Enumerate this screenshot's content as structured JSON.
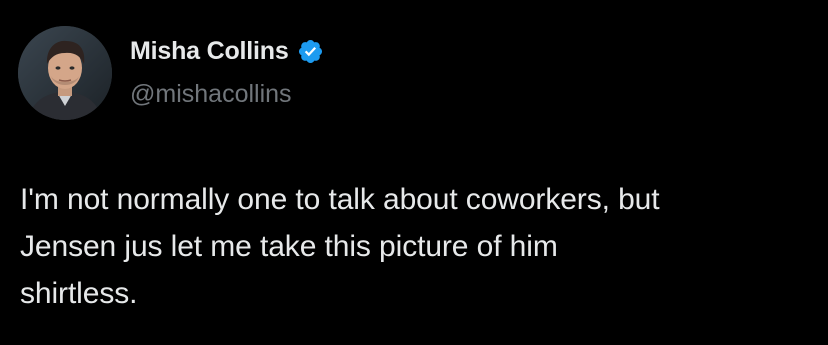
{
  "author": {
    "display_name": "Misha Collins",
    "handle": "@mishacollins",
    "verified": true,
    "verified_icon": "verified-badge-icon",
    "verified_color": "#1d9bf0",
    "avatar_icon": "profile-photo"
  },
  "tweet": {
    "lines": [
      "I'm not normally one to talk about coworkers, but",
      "Jensen jus let me take this picture of him",
      "shirtless."
    ]
  },
  "colors": {
    "background": "#000000",
    "text_primary": "#e7e9ea",
    "text_secondary": "#71767b"
  }
}
